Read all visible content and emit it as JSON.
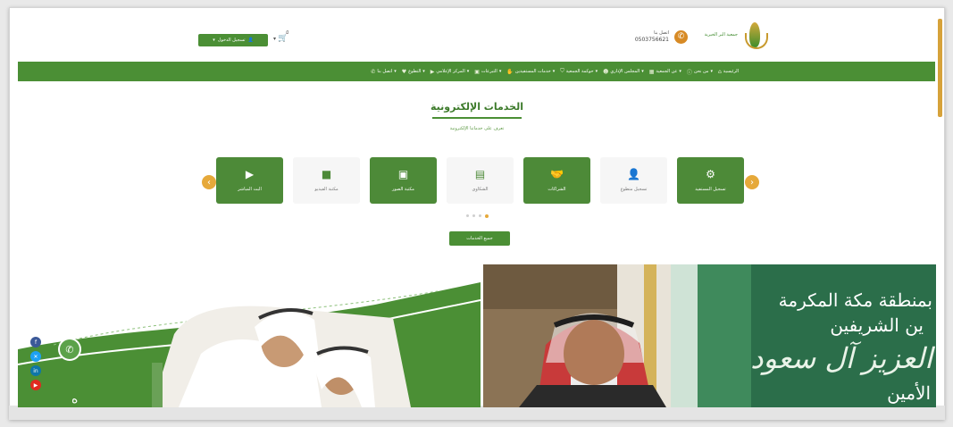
{
  "header": {
    "logo_text": "جمعية البر الخيرية",
    "contact_label": "اتصل بنا",
    "phone": "0503756621",
    "login_label": "تسجيل الدخول",
    "cart_count": "0"
  },
  "nav": {
    "items": [
      {
        "label": "الرئيسية",
        "icon": "home-icon"
      },
      {
        "label": "من نحن",
        "icon": "info-icon"
      },
      {
        "label": "عن الجمعية",
        "icon": "building-icon"
      },
      {
        "label": "المجلس الإداري",
        "icon": "users-icon"
      },
      {
        "label": "حوكمة الجمعية",
        "icon": "shield-icon"
      },
      {
        "label": "خدمات المستفيدين",
        "icon": "hand-icon"
      },
      {
        "label": "التبرعات",
        "icon": "gift-icon"
      },
      {
        "label": "المركز الإعلامي",
        "icon": "media-icon"
      },
      {
        "label": "التطوع",
        "icon": "heart-icon"
      },
      {
        "label": "اتصل بنا",
        "icon": "phone-icon"
      }
    ]
  },
  "services": {
    "title": "الخدمات الإلكترونية",
    "subtitle": "تعرف على خدماتنا الإلكترونية",
    "all_button": "جميع الخدمات",
    "cards": [
      {
        "label": "تسجيل المستفيد",
        "icon": "gears-icon",
        "style": "green"
      },
      {
        "label": "تسجيل متطوع",
        "icon": "person-icon",
        "style": "light"
      },
      {
        "label": "الشراكات",
        "icon": "handshake-icon",
        "style": "green"
      },
      {
        "label": "الشكاوى",
        "icon": "inbox-icon",
        "style": "light"
      },
      {
        "label": "مكتبة الصور",
        "icon": "gallery-icon",
        "style": "green"
      },
      {
        "label": "مكتبة الفيديو",
        "icon": "camera-icon",
        "style": "light"
      },
      {
        "label": "البث المباشر",
        "icon": "youtube-icon",
        "style": "green"
      }
    ],
    "active_dot": 3,
    "dot_count": 4
  },
  "banner": {
    "line1": "بمنطقة مكة المكرمة",
    "line2": "ين الشريفين",
    "line3": "العزيز آل سعود",
    "line4": "الأمين"
  },
  "social": [
    {
      "name": "facebook-icon",
      "color": "#3b5998"
    },
    {
      "name": "twitter-icon",
      "color": "#1da1f2"
    },
    {
      "name": "linkedin-icon",
      "color": "#0e76a8"
    },
    {
      "name": "youtube-icon",
      "color": "#e02a20"
    }
  ],
  "colors": {
    "brand_green": "#4b8f35",
    "accent_orange": "#e6a93a"
  }
}
